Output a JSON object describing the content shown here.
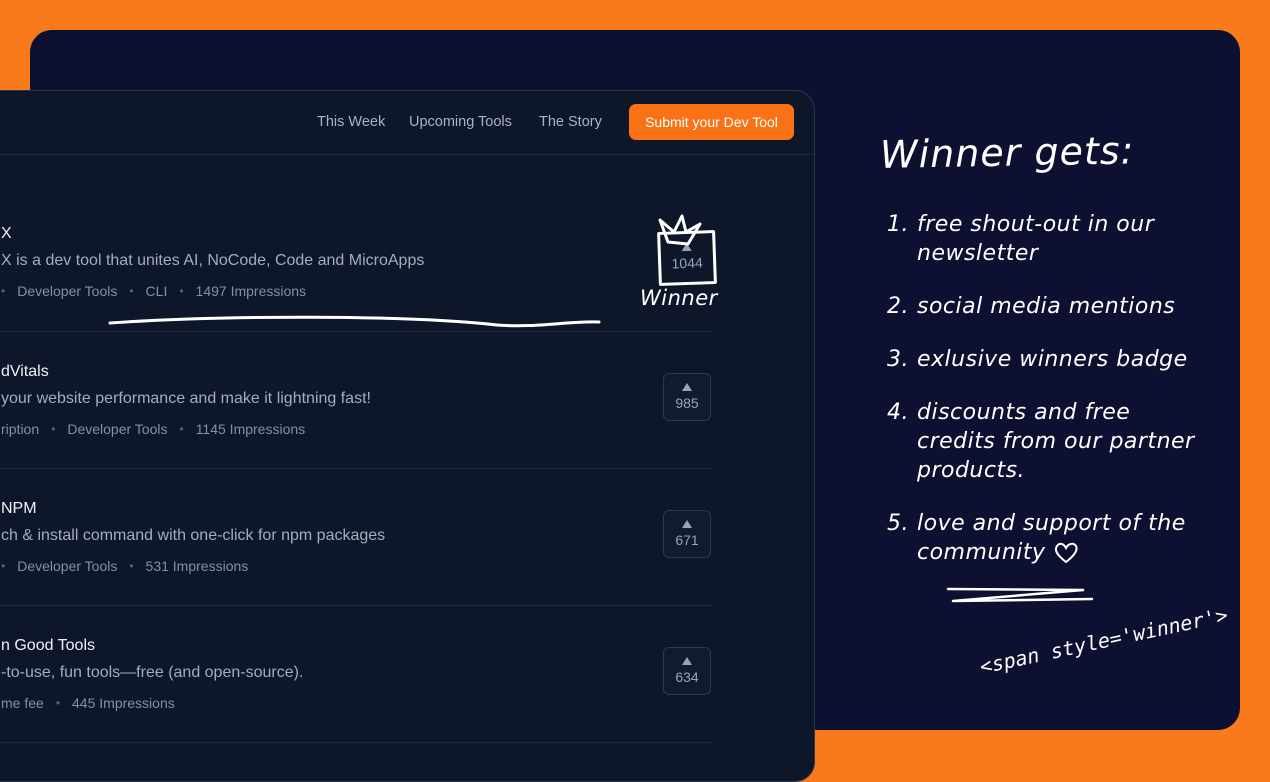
{
  "nav": {
    "links": [
      "This Week",
      "Upcoming Tools",
      "The Story"
    ],
    "submit_label": "Submit your Dev Tool"
  },
  "products": [
    {
      "title": "X",
      "description": "X is a dev tool that unites AI, NoCode, Code and MicroApps",
      "tags": [
        "Developer Tools",
        "CLI",
        "1497 Impressions"
      ],
      "votes": "1044",
      "winner": true
    },
    {
      "title": "dVitals",
      "description": "your website performance and make it lightning fast!",
      "tags": [
        "ription",
        "Developer Tools",
        "1145 Impressions"
      ],
      "votes": "985",
      "winner": false
    },
    {
      "title": "NPM",
      "description": "ch & install command with one-click for npm packages",
      "tags": [
        "Developer Tools",
        "531 Impressions"
      ],
      "votes": "671",
      "winner": false
    },
    {
      "title": "n Good Tools",
      "description": "-to-use, fun tools—free (and open-source).",
      "tags": [
        "me fee",
        "445 Impressions"
      ],
      "votes": "634",
      "winner": false
    }
  ],
  "annotation": {
    "winner_label": "Winner"
  },
  "perks": {
    "title": "Winner gets:",
    "items": [
      {
        "num": "1.",
        "text": "free shout-out in our newsletter"
      },
      {
        "num": "2.",
        "text": "social media mentions"
      },
      {
        "num": "3.",
        "text": "exlusive winners badge"
      },
      {
        "num": "4.",
        "text": "discounts and free credits from our partner products."
      },
      {
        "num": "5.",
        "text": "love and support of the community"
      }
    ],
    "code_tag": "<span style='winner'>"
  },
  "colors": {
    "background": "#f97a1a",
    "card": "#0d1030",
    "app": "#0e1629",
    "accent": "#f97316"
  }
}
